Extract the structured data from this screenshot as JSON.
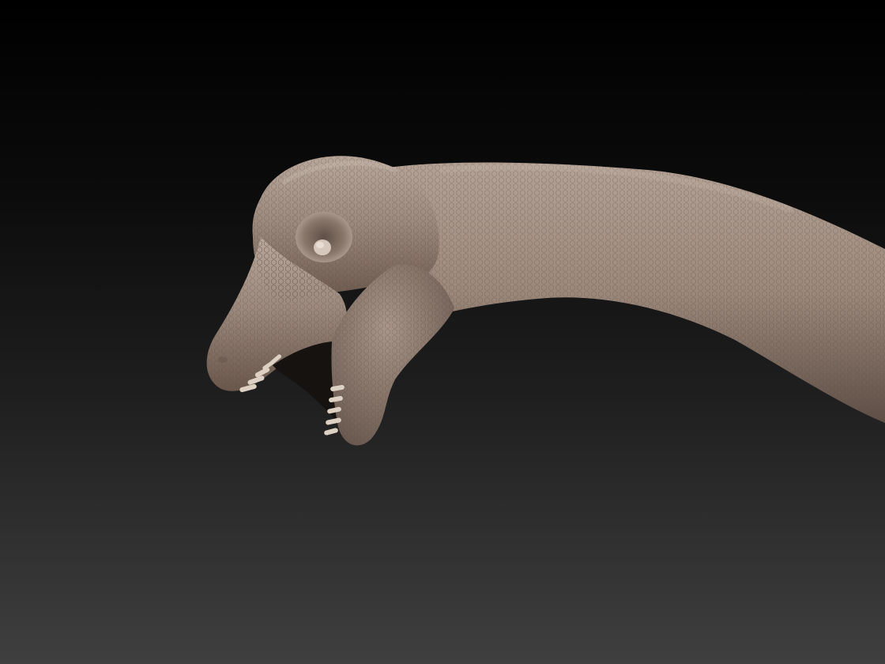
{
  "viewport": {
    "background_top_color": "#000000",
    "background_bottom_color": "#3f3f3f"
  },
  "model": {
    "icon": "sculpted-dinosaur-head-model",
    "skin_color": "#9d8a7e",
    "skin_highlight_color": "#b8a79b",
    "skin_shadow_color": "#5e4e45",
    "teeth_color": "#ddd1c4"
  }
}
